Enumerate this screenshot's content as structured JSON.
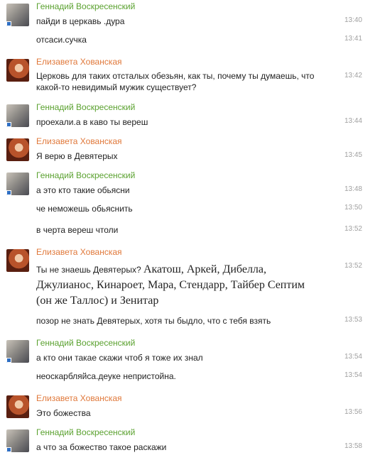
{
  "users": {
    "g": "Геннадий Воскресенский",
    "e": "Елизавета Хованская"
  },
  "groups": [
    {
      "author": "Геннадий Воскресенский",
      "messages": [
        {
          "text": "пайди в церкавь .дура",
          "time": "13:40"
        },
        {
          "text": "отсаси.сучка",
          "time": "13:41"
        }
      ]
    },
    {
      "author": "Елизавета Хованская",
      "messages": [
        {
          "text": "Церковь для таких отсталых обезьян, как ты, почему ты думаешь, что какой-то невидимый мужик существует?",
          "time": "13:42"
        }
      ]
    },
    {
      "author": "Геннадий Воскресенский",
      "messages": [
        {
          "text": "проехали.а в каво ты вереш",
          "time": "13:44"
        }
      ]
    },
    {
      "author": "Елизавета Хованская",
      "messages": [
        {
          "text": "Я верю в Девятерых",
          "time": "13:45"
        }
      ]
    },
    {
      "author": "Геннадий Воскресенский",
      "messages": [
        {
          "text": "а это кто такие обьясни",
          "time": "13:48"
        },
        {
          "text": "че неможешь обьяснить",
          "time": "13:50"
        },
        {
          "text": "в черта вереш чтоли",
          "time": "13:52"
        }
      ]
    },
    {
      "author": "Елизавета Хованская",
      "messages": [
        {
          "text_a": "Ты не знаешь Девятерых? ",
          "text_b": "Акатош, Аркей, Дибелла, Джулианос, Кинароет, Мара, Стендарр, Тайбер Септим (он же Таллос) и Зенитар",
          "time": "13:52"
        },
        {
          "text": "позор не знать Девятерых, хотя ты быдло, что с тебя взять",
          "time": "13:53"
        }
      ]
    },
    {
      "author": "Геннадий Воскресенский",
      "messages": [
        {
          "text": "а кто они такае скажи чтоб я тоже их знал",
          "time": "13:54"
        },
        {
          "text": "неоскарбляйса.деуке непристойна.",
          "time": "13:54"
        }
      ]
    },
    {
      "author": "Елизавета Хованская",
      "messages": [
        {
          "text": "Это божества",
          "time": "13:56"
        }
      ]
    },
    {
      "author": "Геннадий Воскресенский",
      "messages": [
        {
          "text": "а что за божество такое раскажи",
          "time": "13:58"
        }
      ]
    }
  ]
}
